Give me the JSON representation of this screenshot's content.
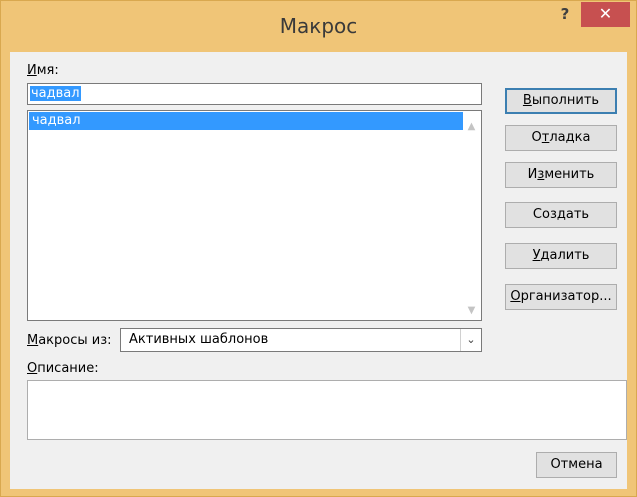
{
  "window": {
    "title": "Макрос",
    "help_glyph": "?",
    "close_glyph": "✕"
  },
  "name_field": {
    "label_pre": "",
    "label_key": "И",
    "label_post": "мя:",
    "value": "чадвал"
  },
  "macro_list": {
    "items": [
      "чадвал"
    ],
    "selected_index": 0
  },
  "buttons": {
    "run": {
      "pre": "",
      "key": "В",
      "post": "ыполнить"
    },
    "debug": {
      "pre": "О",
      "key": "т",
      "post": "ладка"
    },
    "edit": {
      "pre": "И",
      "key": "з",
      "post": "менить"
    },
    "create": {
      "pre": "Соз",
      "key": "д",
      "post": "ать"
    },
    "delete": {
      "pre": "",
      "key": "У",
      "post": "далить"
    },
    "organizer": {
      "pre": "",
      "key": "О",
      "post": "рганизатор..."
    },
    "cancel": {
      "label": "Отмена"
    }
  },
  "macros_from": {
    "label_pre": "",
    "label_key": "М",
    "label_post": "акросы из:",
    "value": "Активных шаблонов"
  },
  "description": {
    "label_pre": "",
    "label_key": "О",
    "label_post": "писание:",
    "value": ""
  },
  "colors": {
    "frame": "#f0c577",
    "close_button": "#c75050",
    "selection": "#3399ff"
  }
}
